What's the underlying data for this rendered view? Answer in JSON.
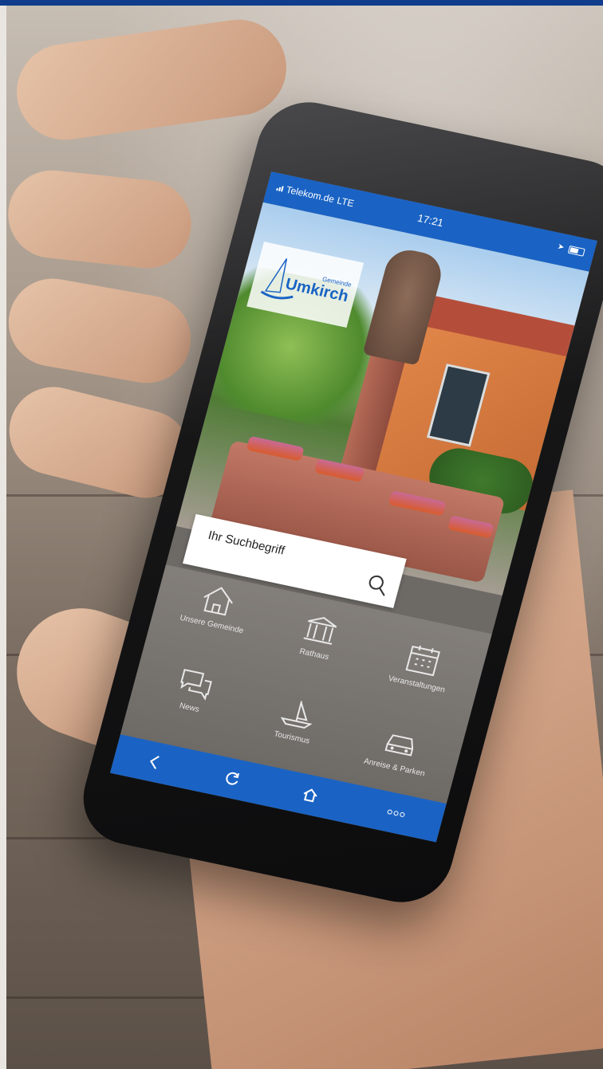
{
  "status_bar": {
    "carrier": "Telekom.de",
    "network": "LTE",
    "time": "17:21"
  },
  "logo": {
    "small_text": "Gemeinde",
    "name": "Umkirch"
  },
  "search": {
    "placeholder": "Ihr Suchbegriff",
    "icon": "search-icon"
  },
  "tiles": [
    {
      "label": "Unsere Gemeinde",
      "icon": "house-icon"
    },
    {
      "label": "Rathaus",
      "icon": "town-hall-icon"
    },
    {
      "label": "Veranstaltungen",
      "icon": "calendar-icon"
    },
    {
      "label": "News",
      "icon": "chat-bubbles-icon"
    },
    {
      "label": "Tourismus",
      "icon": "sailboat-icon"
    },
    {
      "label": "Anreise & Parken",
      "icon": "car-icon"
    }
  ],
  "nav": {
    "back": "back-icon",
    "reload": "reload-icon",
    "home": "home-icon",
    "more": "more-icon"
  },
  "colors": {
    "brand_blue": "#1a63c4",
    "header_strip": "#103c8c"
  }
}
